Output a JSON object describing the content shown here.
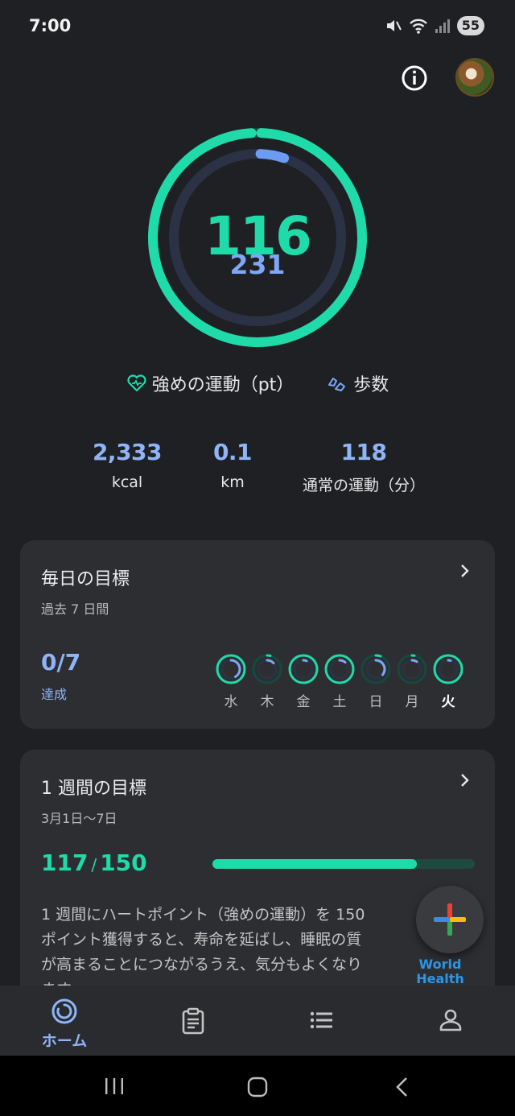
{
  "status_bar": {
    "time": "7:00",
    "battery": "55"
  },
  "rings": {
    "heart_points": "116",
    "steps": "231"
  },
  "legend": {
    "heart_points_label": "強めの運動（pt）",
    "steps_label": "歩数"
  },
  "stats": [
    {
      "value": "2,333",
      "label": "kcal"
    },
    {
      "value": "0.1",
      "label": "km"
    },
    {
      "value": "118",
      "label": "通常の運動（分）"
    }
  ],
  "daily_goal": {
    "title": "毎日の目標",
    "subtitle": "過去 7 日間",
    "count": "0/7",
    "count_label": "達成",
    "days": [
      {
        "label": "水",
        "today": false
      },
      {
        "label": "木",
        "today": false
      },
      {
        "label": "金",
        "today": false
      },
      {
        "label": "土",
        "today": false
      },
      {
        "label": "日",
        "today": false
      },
      {
        "label": "月",
        "today": false
      },
      {
        "label": "火",
        "today": true
      }
    ]
  },
  "weekly_goal": {
    "title": "1 週間の目標",
    "subtitle": "3月1日〜7日",
    "current": "117",
    "separator": "/",
    "target": "150",
    "progress_fraction": 0.78,
    "body": "1 週間にハートポイント（強めの運動）を 150 ポイント獲得すると、寿命を延ばし、睡眠の質が高まることにつながるうえ、気分もよくなります。",
    "logo_text": "World Health Organization"
  },
  "bottom_nav": {
    "home_label": "ホーム"
  },
  "colors": {
    "accent_green": "#1fdbaa",
    "accent_blue": "#8fb4f8",
    "background": "#1f2023",
    "card": "#2d2e31"
  }
}
